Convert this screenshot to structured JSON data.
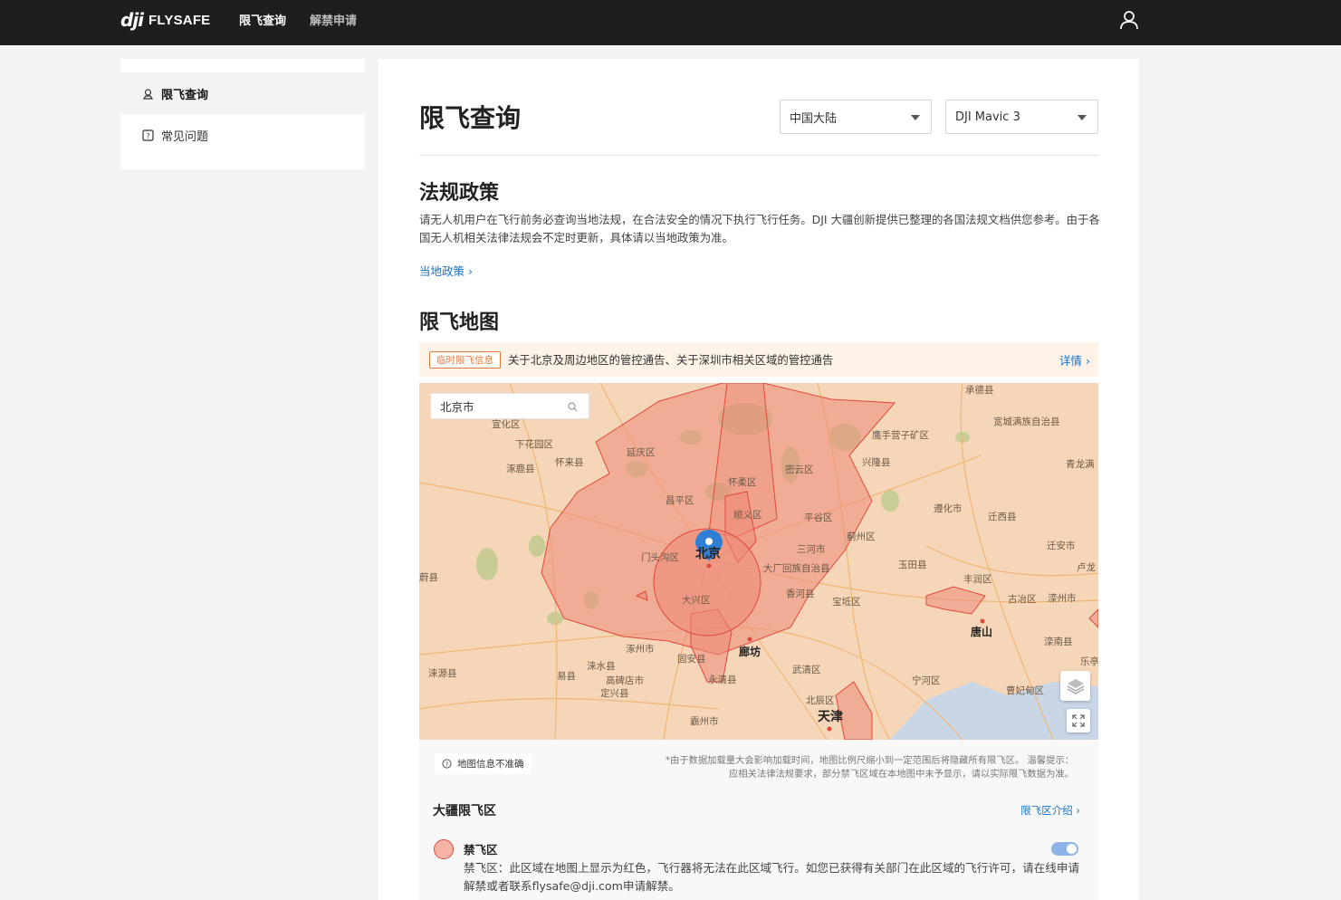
{
  "header": {
    "brand_mark": "dji",
    "brand_text": "FLYSAFE",
    "nav": [
      {
        "label": "限飞查询",
        "active": true
      },
      {
        "label": "解禁申请",
        "active": false
      }
    ],
    "user_icon": "user-icon"
  },
  "sidebar": {
    "items": [
      {
        "label": "限飞查询",
        "icon": "restricted-flight-icon",
        "active": true
      },
      {
        "label": "常见问题",
        "icon": "question-icon",
        "active": false
      }
    ]
  },
  "main": {
    "title": "限飞查询",
    "region_select": {
      "value": "中国大陆"
    },
    "model_select": {
      "value": "DJI Mavic 3"
    },
    "policy": {
      "title": "法规政策",
      "text": "请无人机用户在飞行前务必查询当地法规，在合法安全的情况下执行飞行任务。DJI 大疆创新提供已整理的各国法规文档供您参考。由于各国无人机相关法律法规会不定时更新，具体请以当地政策为准。",
      "link": "当地政策"
    },
    "map_section": {
      "title": "限飞地图",
      "notice_badge": "临时限飞信息",
      "notice_text": "关于北京及周边地区的管控通告、关于深圳市相关区域的管控通告",
      "notice_more": "详情",
      "search_value": "北京市",
      "labels": [
        "承德县",
        "宣化区",
        "宽城满族自治县",
        "下花园区",
        "鹰手营子矿区",
        "涿鹿县",
        "怀来县",
        "延庆区",
        "兴隆县",
        "青龙满",
        "怀柔区",
        "密云区",
        "昌平区",
        "顺义区",
        "遵化市",
        "迁西县",
        "平谷区",
        "蓟州区",
        "迁安市",
        "门头沟区",
        "北京",
        "三河市",
        "玉田县",
        "卢龙",
        "蔚县",
        "大厂回族自治县",
        "丰润区",
        "香河县",
        "古冶区",
        "滦州市",
        "大兴区",
        "宝坻区",
        "唐山",
        "涿州市",
        "廊坊",
        "滦南县",
        "乐亭",
        "涞源县",
        "涞水县",
        "固安县",
        "武清区",
        "易县",
        "高碑店市",
        "永清县",
        "宁河区",
        "定兴县",
        "曹妃甸区",
        "霸州市",
        "北辰区",
        "天津"
      ]
    },
    "map_footer": {
      "inaccurate": "地图信息不准确",
      "disclaimer_1": "*由于数据加载量大会影响加载时间，地图比例尺缩小到一定范围后将隐藏所有限飞区。 温馨提示：",
      "disclaimer_2": "应相关法律法规要求，部分禁飞区域在本地图中未予显示，请以实际限飞数据为准。",
      "zones_title": "大疆限飞区",
      "zones_link": "限飞区介绍",
      "zone": {
        "name": "禁飞区",
        "desc": "禁飞区：此区域在地图上显示为红色，飞行器将无法在此区域飞行。如您已获得有关部门在此区域的飞行许可，请在线申请解禁或者联系flysafe@dji.com申请解禁。",
        "enabled": true
      }
    }
  },
  "colors": {
    "topbar": "#1e1e1e",
    "link": "#1a73c9",
    "zone_red": "#e04a3a",
    "notice_bg": "#fdf3e7",
    "notice_accent": "#e0793a"
  }
}
